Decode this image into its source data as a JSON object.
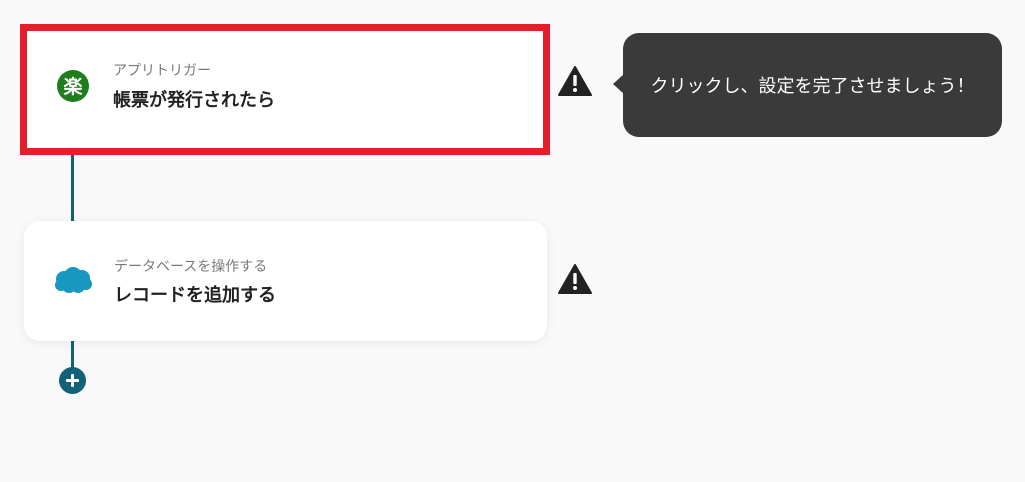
{
  "flow": {
    "steps": [
      {
        "subtitle": "アプリトリガー",
        "title": "帳票が発行されたら",
        "icon": "rakuten-app-icon",
        "icon_glyph": "楽",
        "icon_color": "#1e7e1e",
        "highlighted": true
      },
      {
        "subtitle": "データベースを操作する",
        "title": "レコードを追加する",
        "icon": "salesforce-cloud-icon",
        "icon_color": "#1798c1",
        "highlighted": false
      }
    ],
    "add_button_icon": "plus-icon"
  },
  "tooltip": {
    "text": "クリックし、設定を完了させましょう！"
  },
  "colors": {
    "background": "#f9f9f9",
    "highlight_border": "#e41e2b",
    "connector": "#0f6278",
    "tooltip_bg": "#3a3a3a",
    "warning": "#222222"
  }
}
